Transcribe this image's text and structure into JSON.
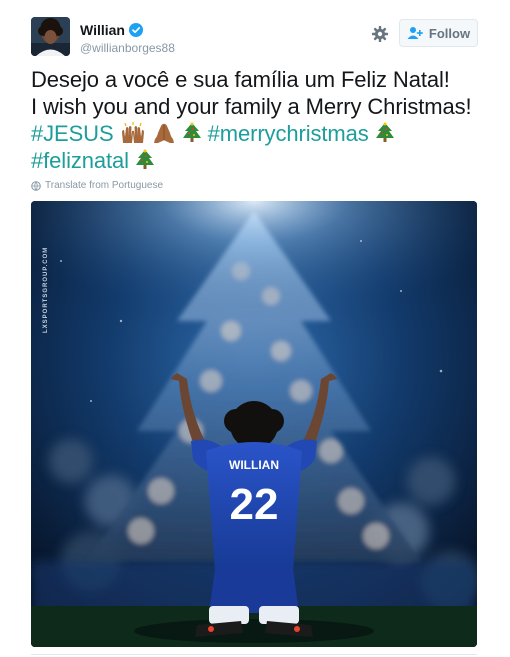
{
  "author": {
    "display_name": "Willian",
    "handle": "@willianborges88",
    "verified": true
  },
  "actions": {
    "settings_icon": "gear-icon",
    "follow_label": "Follow"
  },
  "tweet": {
    "line1": "Desejo a você e sua família um Feliz Natal!",
    "line2": "I wish you and your family a Merry Christmas!",
    "hashtag_jesus": "#JESUS",
    "hashtag_merrychristmas": "#merrychristmas",
    "hashtag_feliznatal": "#feliznatal",
    "emojis": [
      "raising-hands",
      "folded-hands",
      "christmas-tree",
      "christmas-tree",
      "christmas-tree"
    ]
  },
  "translate": {
    "label": "Translate from Portuguese"
  },
  "media": {
    "watermark": "LXSPORTSGROUP.COM",
    "jersey_name": "WILLIAN",
    "jersey_number": "22"
  },
  "colors": {
    "hashtag": "#1d9e9c",
    "verified": "#1da1f2",
    "muted": "#8899a6"
  }
}
